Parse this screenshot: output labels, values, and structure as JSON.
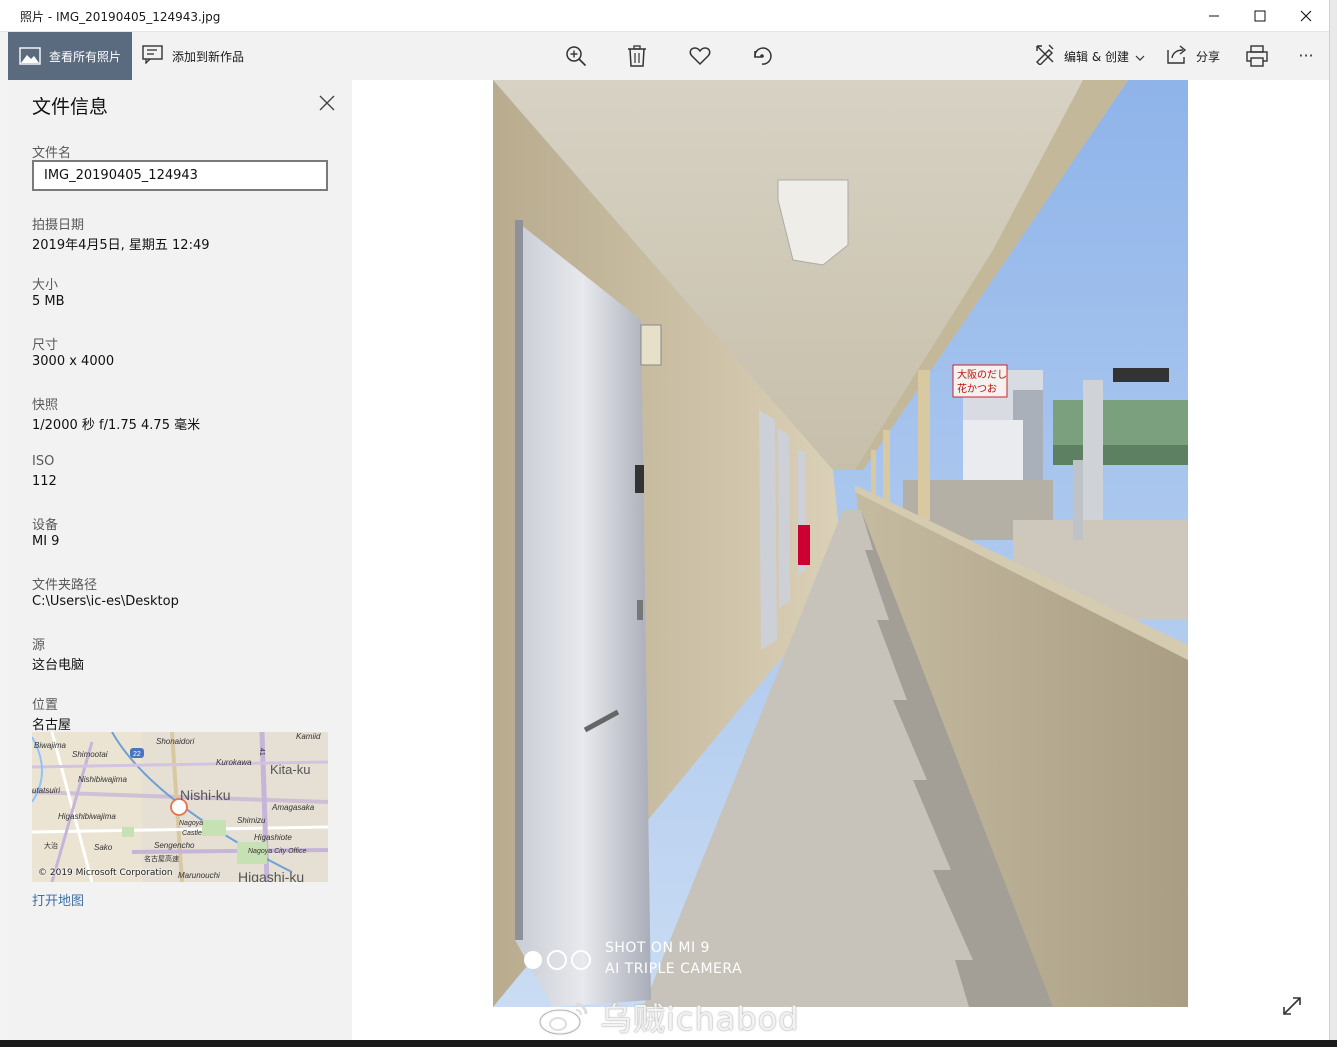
{
  "window": {
    "title": "照片 - IMG_20190405_124943.jpg"
  },
  "toolbar": {
    "view_all_label": "查看所有照片",
    "add_to_creation_label": "添加到新作品",
    "edit_create_label": "编辑 & 创建",
    "share_label": "分享",
    "more_label": "···",
    "icons": [
      "zoom-in-icon",
      "delete-icon",
      "heart-icon",
      "rotate-icon",
      "edit-create-icon",
      "share-icon",
      "print-icon"
    ]
  },
  "file_info": {
    "title": "文件信息",
    "filename_label": "文件名",
    "filename_value": "IMG_20190405_124943",
    "date_label": "拍摄日期",
    "date_value": "2019年4月5日, 星期五 12:49",
    "size_label": "大小",
    "size_value": "5 MB",
    "dimensions_label": "尺寸",
    "dimensions_value": "3000 x 4000",
    "snapshot_label": "快照",
    "snapshot_value": "1/2000 秒 f/1.75 4.75 毫米",
    "iso_label": "ISO",
    "iso_value": "112",
    "device_label": "设备",
    "device_value": "MI 9",
    "folder_label": "文件夹路径",
    "folder_value": "C:\\Users\\ic-es\\Desktop",
    "source_label": "源",
    "source_value": "这台电脑",
    "location_label": "位置",
    "location_value": "名古屋",
    "open_map_label": "打开地图"
  },
  "map": {
    "labels": {
      "biwajima": "Biwajima",
      "shimootai": "Shimootai",
      "shonaidori": "Shonaidori",
      "kamiid": "Kamiid",
      "nishibiwajima": "Nishibiwajima",
      "kurokawa": "Kurokawa",
      "kitaku": "Kita-ku",
      "utatsuiri": "utatsuiri",
      "nishiku": "Nishi-ku",
      "amagasaka": "Amagasaka",
      "higashibiwajima": "Higashibiwajima",
      "nagoya": "Nagoya",
      "castle": "Castle",
      "shimizu": "Shimizu",
      "higashiote": "Higashiote",
      "sako": "Sako",
      "sengencho": "Sengencho",
      "nagoyacity": "Nagoya City Office",
      "daiji": "大治",
      "meishi": "名古屋高速",
      "marunouchi": "Marunouchi",
      "higashiku": "Higashi-ku",
      "road22": "22",
      "road41": "41"
    },
    "copyright": "© 2019 Microsoft Corporation"
  },
  "photo": {
    "shot_on_line1": "SHOT ON MI 9",
    "shot_on_line2": "AI TRIPLE CAMERA",
    "sign_top": "大阪のだし",
    "sign_bottom": "花かつお"
  },
  "watermark": {
    "text": "乌贼ichabod"
  }
}
